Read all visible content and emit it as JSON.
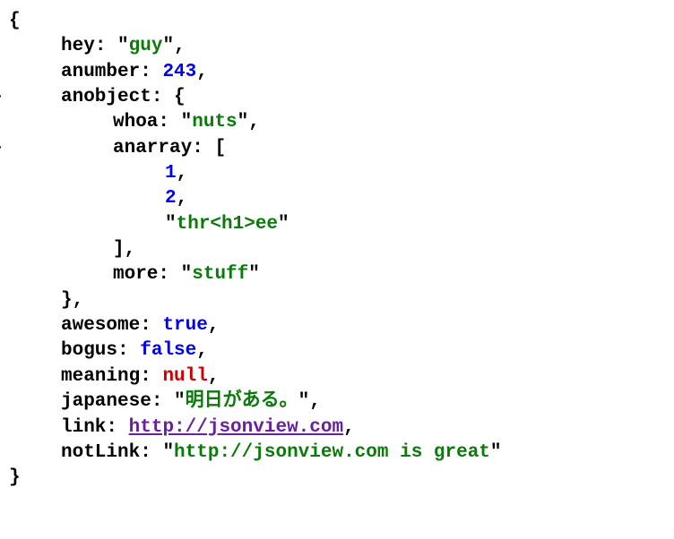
{
  "json": {
    "open_brace": "{",
    "close_brace": "}",
    "open_bracket": "[",
    "close_bracket": "]",
    "comma": ",",
    "colon": ":",
    "quote": "\"",
    "collapser": "–",
    "items": {
      "hey": {
        "key": "hey",
        "value": "guy"
      },
      "anumber": {
        "key": "anumber",
        "value": "243"
      },
      "anobject": {
        "key": "anobject",
        "whoa": {
          "key": "whoa",
          "value": "nuts"
        },
        "anarray": {
          "key": "anarray",
          "item0": "1",
          "item1": "2",
          "item2": "thr<h1>ee"
        },
        "more": {
          "key": "more",
          "value": "stuff"
        }
      },
      "awesome": {
        "key": "awesome",
        "value": "true"
      },
      "bogus": {
        "key": "bogus",
        "value": "false"
      },
      "meaning": {
        "key": "meaning",
        "value": "null"
      },
      "japanese": {
        "key": "japanese",
        "value": "明日がある。"
      },
      "link": {
        "key": "link",
        "value": "http://jsonview.com"
      },
      "notLink": {
        "key": "notLink",
        "value": "http://jsonview.com is great"
      }
    }
  }
}
